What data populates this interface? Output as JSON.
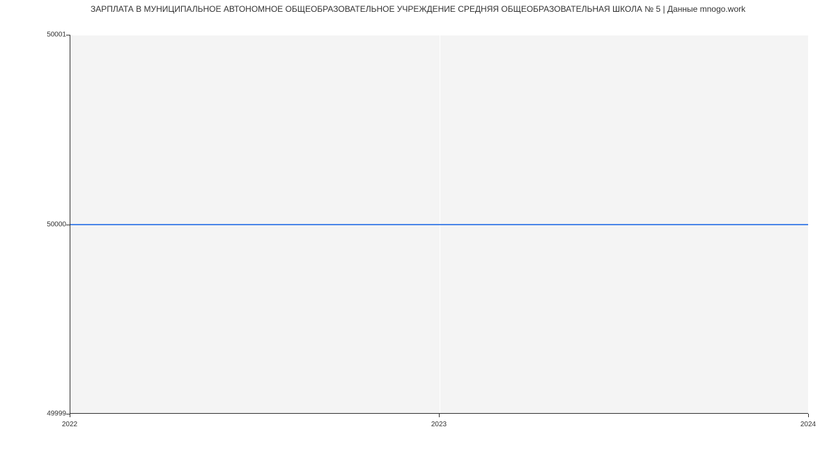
{
  "chart_data": {
    "type": "line",
    "title": "ЗАРПЛАТА В МУНИЦИПАЛЬНОЕ АВТОНОМНОЕ ОБЩЕОБРАЗОВАТЕЛЬНОЕ УЧРЕЖДЕНИЕ СРЕДНЯЯ ОБЩЕОБРАЗОВАТЕЛЬНАЯ ШКОЛА № 5 | Данные mnogo.work",
    "xlabel": "",
    "ylabel": "",
    "x": [
      2022,
      2023,
      2024
    ],
    "values": [
      50000,
      50000,
      50000
    ],
    "x_ticks": [
      "2022",
      "2023",
      "2024"
    ],
    "y_ticks": [
      "49999",
      "50000",
      "50001"
    ],
    "xlim": [
      2022,
      2024
    ],
    "ylim": [
      49999,
      50001
    ]
  }
}
